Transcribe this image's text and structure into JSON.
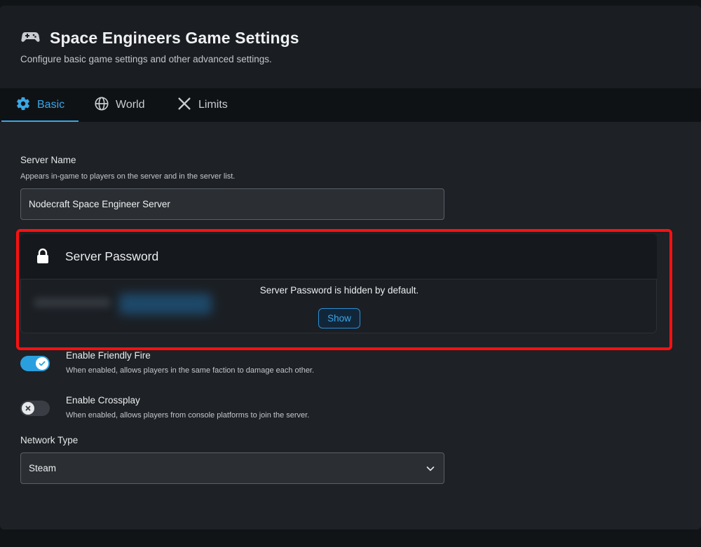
{
  "header": {
    "title": "Space Engineers Game Settings",
    "subtitle": "Configure basic game settings and other advanced settings.",
    "icon": "gamepad-icon"
  },
  "tabs": [
    {
      "label": "Basic",
      "icon": "gear-icon",
      "active": true
    },
    {
      "label": "World",
      "icon": "globe-icon",
      "active": false
    },
    {
      "label": "Limits",
      "icon": "close-icon",
      "active": false
    }
  ],
  "server_name": {
    "label": "Server Name",
    "hint": "Appears in-game to players on the server and in the server list.",
    "value": "Nodecraft Space Engineer Server"
  },
  "server_password": {
    "title": "Server Password",
    "icon": "lock-icon",
    "message": "Server Password is hidden by default.",
    "show_label": "Show"
  },
  "friendly_fire": {
    "title": "Enable Friendly Fire",
    "description": "When enabled, allows players in the same faction to damage each other.",
    "enabled": true
  },
  "crossplay": {
    "title": "Enable Crossplay",
    "description": "When enabled, allows players from console platforms to join the server.",
    "enabled": false
  },
  "network_type": {
    "label": "Network Type",
    "value": "Steam"
  },
  "colors": {
    "accent": "#3ba7e6",
    "highlight": "#ff1010",
    "background": "#1e2125"
  }
}
